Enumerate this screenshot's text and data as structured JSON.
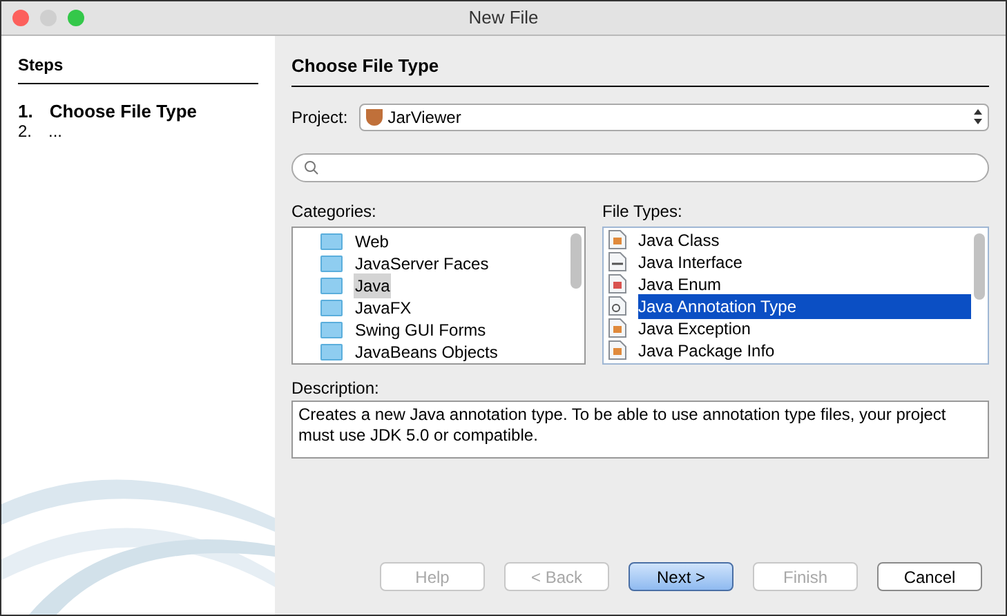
{
  "window": {
    "title": "New File"
  },
  "steps": {
    "title": "Steps",
    "items": [
      {
        "number": "1.",
        "label": "Choose File Type",
        "selected": true
      },
      {
        "number": "2.",
        "label": "...",
        "selected": false
      }
    ]
  },
  "panel_title": "Choose File Type",
  "project": {
    "label": "Project:",
    "value": "JarViewer"
  },
  "categories": {
    "label": "Categories:",
    "items": [
      {
        "label": "Web",
        "selected": false
      },
      {
        "label": "JavaServer Faces",
        "selected": false
      },
      {
        "label": "Java",
        "selected": true
      },
      {
        "label": "JavaFX",
        "selected": false
      },
      {
        "label": "Swing GUI Forms",
        "selected": false
      },
      {
        "label": "JavaBeans Objects",
        "selected": false
      }
    ]
  },
  "file_types": {
    "label": "File Types:",
    "items": [
      {
        "label": "Java Class",
        "kind": "class",
        "selected": false
      },
      {
        "label": "Java Interface",
        "kind": "interface",
        "selected": false
      },
      {
        "label": "Java Enum",
        "kind": "enum",
        "selected": false
      },
      {
        "label": "Java Annotation Type",
        "kind": "annotation",
        "selected": true
      },
      {
        "label": "Java Exception",
        "kind": "class",
        "selected": false
      },
      {
        "label": "Java Package Info",
        "kind": "class",
        "selected": false
      }
    ]
  },
  "description": {
    "label": "Description:",
    "text": "Creates a new Java annotation type. To be able to use annotation type files, your project must use JDK 5.0 or compatible."
  },
  "buttons": [
    {
      "label": "Help",
      "disabled": true,
      "default": false
    },
    {
      "label": "< Back",
      "disabled": true,
      "default": false
    },
    {
      "label": "Next >",
      "disabled": false,
      "default": true
    },
    {
      "label": "Finish",
      "disabled": true,
      "default": false
    },
    {
      "label": "Cancel",
      "disabled": false,
      "default": false
    }
  ]
}
